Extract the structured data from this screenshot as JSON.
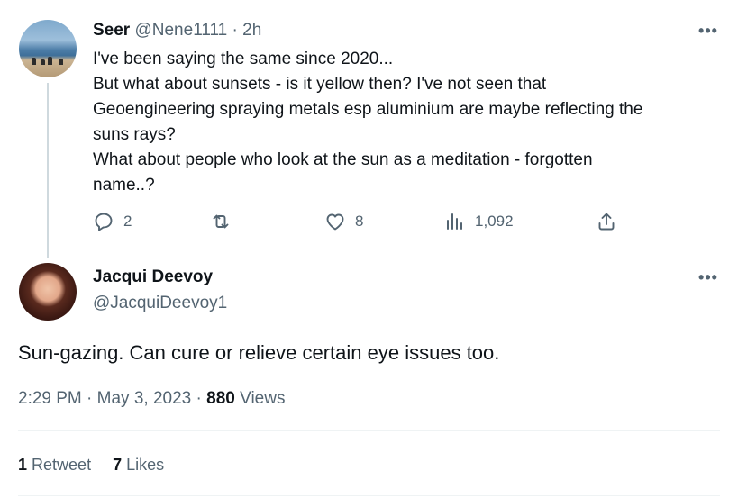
{
  "reply": {
    "name": "Seer",
    "handle": "@Nene1111",
    "separator": "·",
    "time": "2h",
    "more": "•••",
    "lines": [
      "I've been saying the same since 2020...",
      "But what about sunsets - is it yellow then? I've not seen that",
      "Geoengineering spraying metals esp aluminium are maybe reflecting the",
      "suns rays?",
      "What about people who look at the sun as a meditation - forgotten",
      "name..?"
    ],
    "actions": {
      "replies": "2",
      "retweets": "",
      "likes": "8",
      "views": "1,092"
    }
  },
  "tweet": {
    "name": "Jacqui Deevoy",
    "handle": "@JacquiDeevoy1",
    "more": "•••",
    "text": "Sun-gazing. Can cure or relieve certain eye issues too.",
    "time": "2:29 PM",
    "date": "May 3, 2023",
    "separator": "·",
    "views_count": "880",
    "views_label": "Views",
    "retweets_count": "1",
    "retweets_label": "Retweet",
    "likes_count": "7",
    "likes_label": "Likes"
  },
  "icons": [
    "reply-icon",
    "retweet-icon",
    "like-icon",
    "views-icon",
    "share-icon",
    "more-icon"
  ],
  "colors": {
    "text": "#0f1419",
    "muted": "#536471",
    "line": "#cfd9de",
    "divider": "#eff3f4"
  }
}
